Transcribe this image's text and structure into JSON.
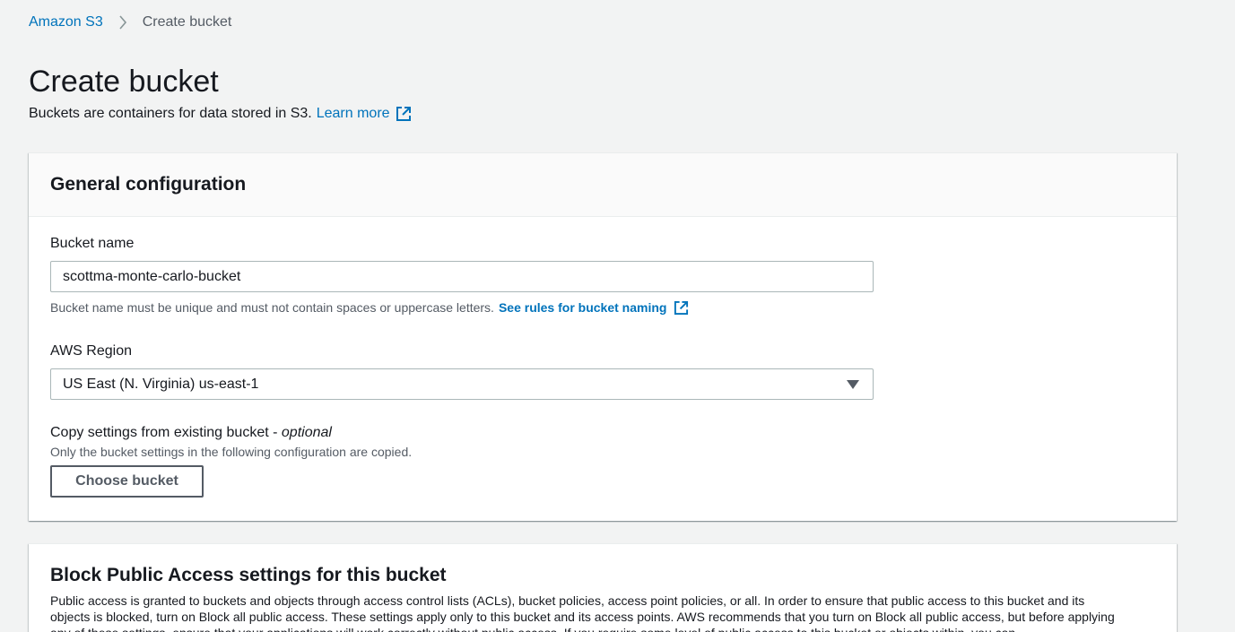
{
  "breadcrumb": {
    "root": "Amazon S3",
    "current": "Create bucket"
  },
  "header": {
    "title": "Create bucket",
    "description": "Buckets are containers for data stored in S3.",
    "learn_more": "Learn more"
  },
  "general_configuration": {
    "title": "General configuration",
    "bucket_name": {
      "label": "Bucket name",
      "value": "scottma-monte-carlo-bucket",
      "hint": "Bucket name must be unique and must not contain spaces or uppercase letters.",
      "rules_link": "See rules for bucket naming"
    },
    "region": {
      "label": "AWS Region",
      "selected": "US East (N. Virginia) us-east-1"
    },
    "copy_settings": {
      "label": "Copy settings from existing bucket - ",
      "label_optional": "optional",
      "description": "Only the bucket settings in the following configuration are copied.",
      "button": "Choose bucket"
    }
  },
  "block_public_access": {
    "title": "Block Public Access settings for this bucket",
    "description": "Public access is granted to buckets and objects through access control lists (ACLs), bucket policies, access point policies, or all. In order to ensure that public access to this bucket and its objects is blocked, turn on Block all public access. These settings apply only to this bucket and its access points. AWS recommends that you turn on Block all public access, but before applying any of these settings, ensure that your applications will work correctly without public access. If you require some level of public access to this bucket or objects within, you can"
  },
  "colors": {
    "link": "#0073bb",
    "text": "#16191f",
    "secondary_text": "#545b64",
    "page_background": "#f2f3f3"
  },
  "icons": {
    "breadcrumb_separator": "chevron-right-icon",
    "external_link": "external-link-icon",
    "dropdown": "caret-down-icon"
  }
}
